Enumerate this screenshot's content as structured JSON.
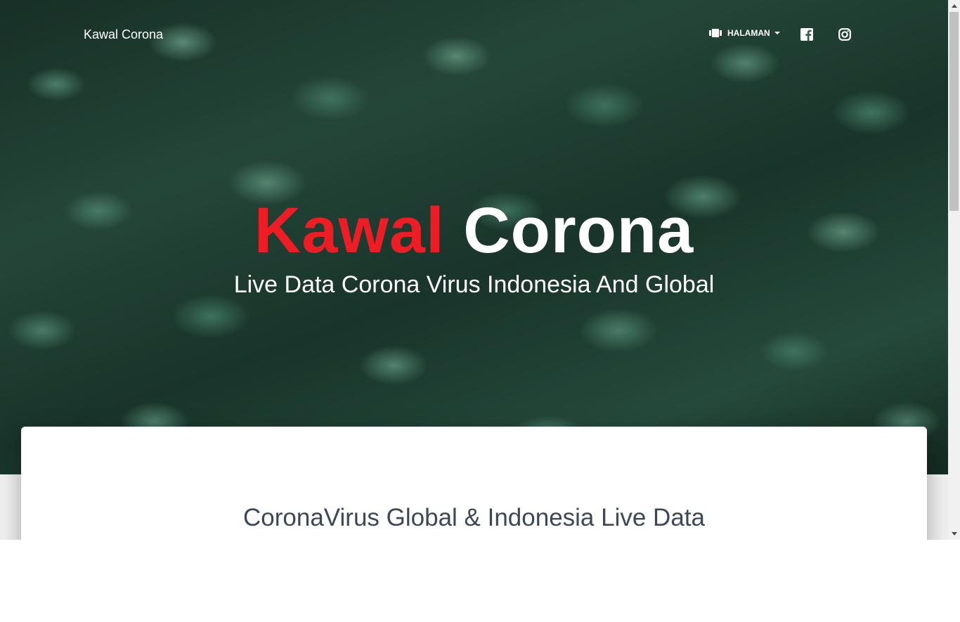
{
  "navbar": {
    "brand": "Kawal Corona",
    "menu_label": "HALAMAN",
    "menu_icon": "view-carousel-icon",
    "social": [
      {
        "name": "facebook",
        "icon": "facebook-icon"
      },
      {
        "name": "instagram",
        "icon": "instagram-icon"
      }
    ]
  },
  "hero": {
    "title_part1": "Kawal",
    "title_part2": "Corona",
    "subtitle": "Live Data Corona Virus Indonesia And Global",
    "title_accent_color": "#ee1c25"
  },
  "main": {
    "heading": "CoronaVirus Global & Indonesia Live Data"
  },
  "colors": {
    "heading_text": "#3c4858",
    "card_bg": "#ffffff",
    "page_bg": "#eeeeee"
  }
}
